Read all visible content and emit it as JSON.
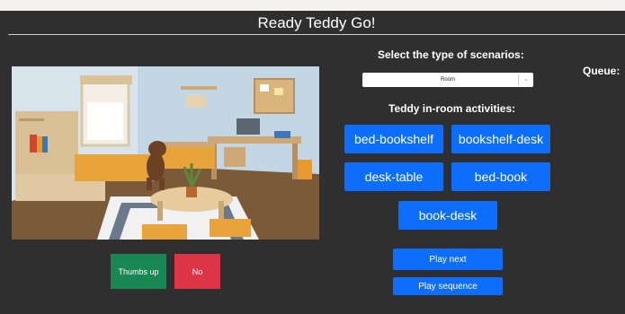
{
  "title": "Ready Teddy Go!",
  "scenario": {
    "label": "Select the type of scenarios:",
    "selected": "Room"
  },
  "queue_label": "Queue:",
  "activities": {
    "label": "Teddy in-room activities:",
    "buttons": [
      "bed-bookshelf",
      "bookshelf-desk",
      "desk-table",
      "bed-book",
      "book-desk"
    ]
  },
  "controls": {
    "thumbs_up": "Thumbs up",
    "no": "No",
    "play_next": "Play next",
    "play_sequence": "Play sequence"
  },
  "colors": {
    "background": "#2f2f2f",
    "primary": "#0d6efd",
    "success": "#198754",
    "danger": "#dc3545"
  },
  "icons": [
    "chevron-down-icon"
  ]
}
